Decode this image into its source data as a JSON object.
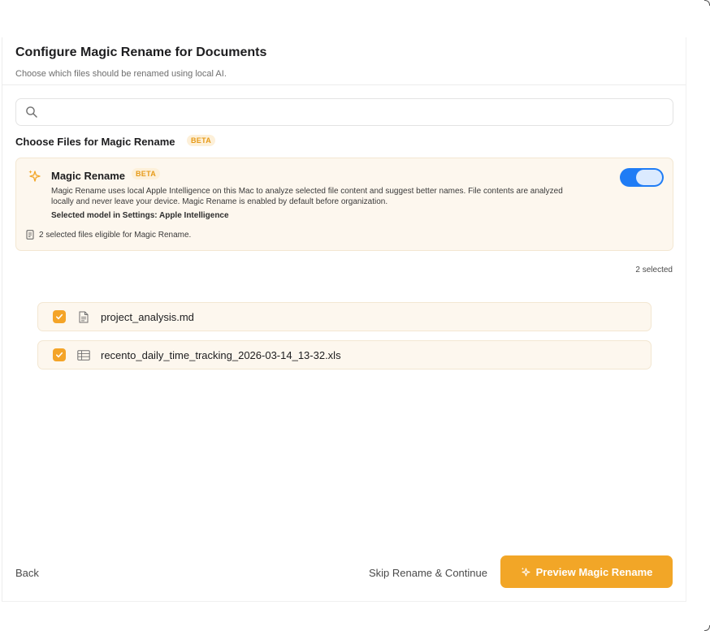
{
  "header": {
    "title": "Configure Magic Rename for Documents",
    "subtitle": "Choose which files should be renamed using local AI."
  },
  "search": {
    "value": "",
    "placeholder": "",
    "icon": "search-icon"
  },
  "section": {
    "title": "Choose Files for Magic Rename",
    "badge": "BETA"
  },
  "magic_card": {
    "icon": "sparkle-icon",
    "title": "Magic Rename",
    "badge": "BETA",
    "description": "Magic Rename uses local Apple Intelligence on this Mac to analyze selected file content and suggest better names. File contents are analyzed locally and never leave your device. Magic Rename is enabled by default before organization.",
    "model": "Selected model in Settings: Apple Intelligence",
    "eligible": "2 selected files eligible for Magic Rename.",
    "toggle_on": true
  },
  "selection_count": "2 selected",
  "files": [
    {
      "name": "project_analysis.md",
      "icon": "document-icon",
      "checked": true
    },
    {
      "name": "recento_daily_time_tracking_2026-03-14_13-32.xls",
      "icon": "table-icon",
      "checked": true
    }
  ],
  "footer": {
    "back": "Back",
    "skip": "Skip Rename & Continue",
    "primary": "Preview Magic Rename"
  },
  "colors": {
    "accent": "#f2a627",
    "toggle": "#1f7cf5",
    "card_bg": "#fdf7ee",
    "badge_text": "#e69a18"
  }
}
